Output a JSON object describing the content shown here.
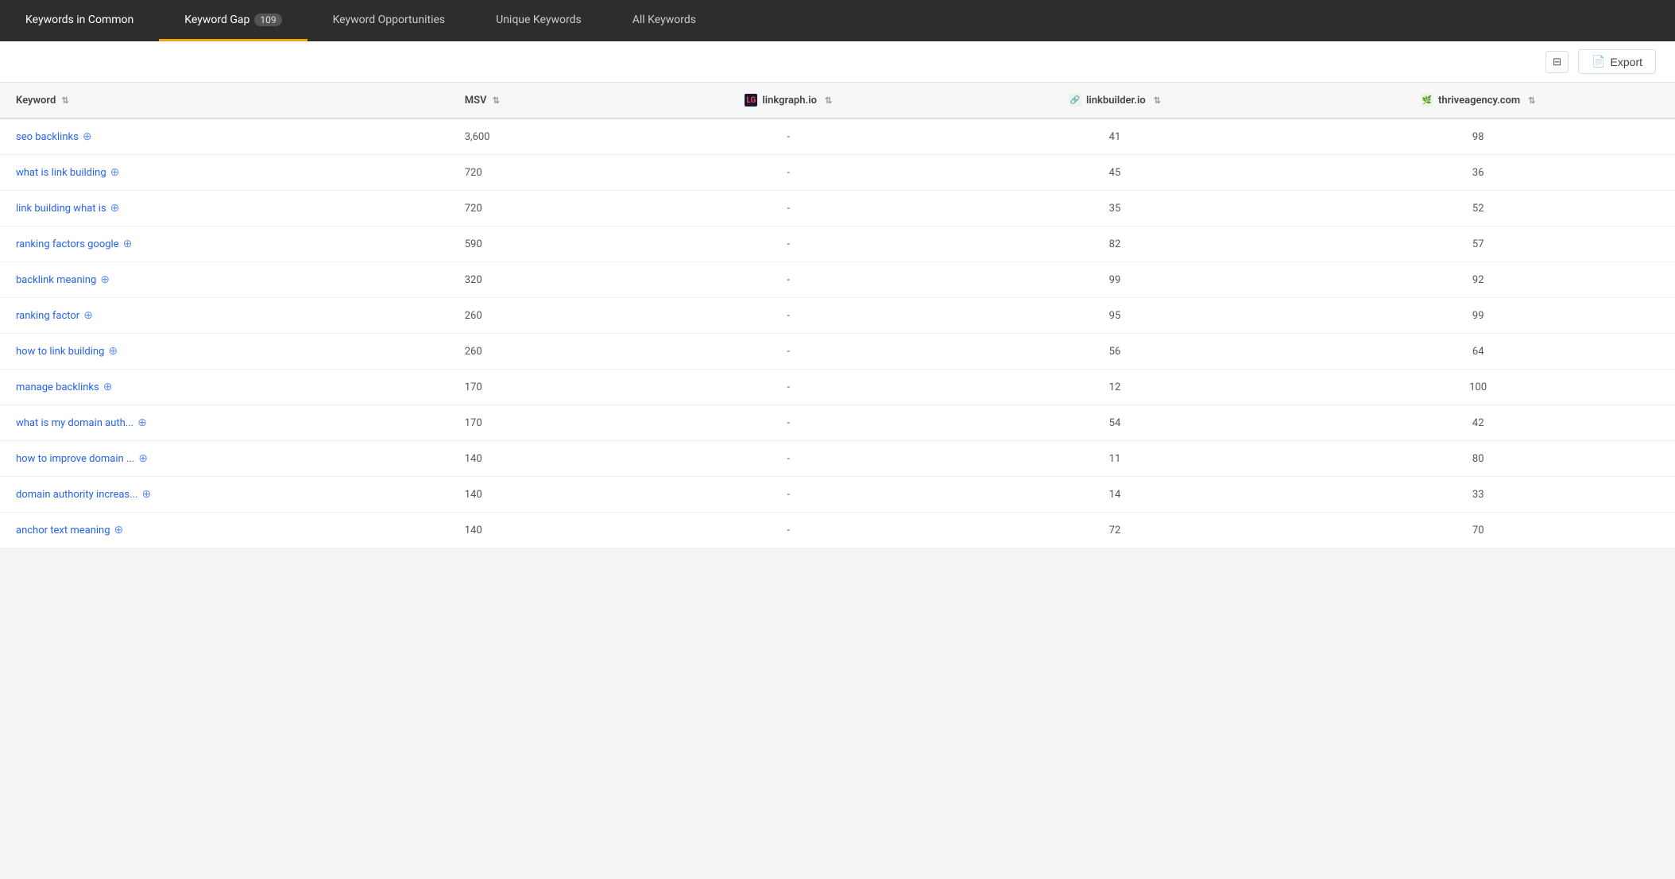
{
  "tabs": [
    {
      "id": "keywords-in-common",
      "label": "Keywords in Common",
      "badge": null,
      "active": false
    },
    {
      "id": "keyword-gap",
      "label": "Keyword Gap",
      "badge": "109",
      "active": true
    },
    {
      "id": "keyword-opportunities",
      "label": "Keyword Opportunities",
      "badge": null,
      "active": false
    },
    {
      "id": "unique-keywords",
      "label": "Unique Keywords",
      "badge": null,
      "active": false
    },
    {
      "id": "all-keywords",
      "label": "All Keywords",
      "badge": null,
      "active": false
    }
  ],
  "toolbar": {
    "export_label": "Export",
    "columns_icon": "⊟"
  },
  "table": {
    "columns": [
      {
        "id": "keyword",
        "label": "Keyword",
        "sortable": true
      },
      {
        "id": "msv",
        "label": "MSV",
        "sortable": true
      },
      {
        "id": "linkgraph",
        "label": "linkgraph.io",
        "sortable": true
      },
      {
        "id": "linkbuilder",
        "label": "linkbuilder.io",
        "sortable": true
      },
      {
        "id": "thrive",
        "label": "thriveagency.com",
        "sortable": true
      }
    ],
    "rows": [
      {
        "keyword": "seo backlinks",
        "msv": "3,600",
        "linkgraph": "-",
        "linkbuilder": "41",
        "thrive": "98"
      },
      {
        "keyword": "what is link building",
        "msv": "720",
        "linkgraph": "-",
        "linkbuilder": "45",
        "thrive": "36"
      },
      {
        "keyword": "link building what is",
        "msv": "720",
        "linkgraph": "-",
        "linkbuilder": "35",
        "thrive": "52"
      },
      {
        "keyword": "ranking factors google",
        "msv": "590",
        "linkgraph": "-",
        "linkbuilder": "82",
        "thrive": "57"
      },
      {
        "keyword": "backlink meaning",
        "msv": "320",
        "linkgraph": "-",
        "linkbuilder": "99",
        "thrive": "92"
      },
      {
        "keyword": "ranking factor",
        "msv": "260",
        "linkgraph": "-",
        "linkbuilder": "95",
        "thrive": "99"
      },
      {
        "keyword": "how to link building",
        "msv": "260",
        "linkgraph": "-",
        "linkbuilder": "56",
        "thrive": "64"
      },
      {
        "keyword": "manage backlinks",
        "msv": "170",
        "linkgraph": "-",
        "linkbuilder": "12",
        "thrive": "100"
      },
      {
        "keyword": "what is my domain auth...",
        "msv": "170",
        "linkgraph": "-",
        "linkbuilder": "54",
        "thrive": "42"
      },
      {
        "keyword": "how to improve domain ...",
        "msv": "140",
        "linkgraph": "-",
        "linkbuilder": "11",
        "thrive": "80"
      },
      {
        "keyword": "domain authority increas...",
        "msv": "140",
        "linkgraph": "-",
        "linkbuilder": "14",
        "thrive": "33"
      },
      {
        "keyword": "anchor text meaning",
        "msv": "140",
        "linkgraph": "-",
        "linkbuilder": "72",
        "thrive": "70"
      }
    ]
  }
}
